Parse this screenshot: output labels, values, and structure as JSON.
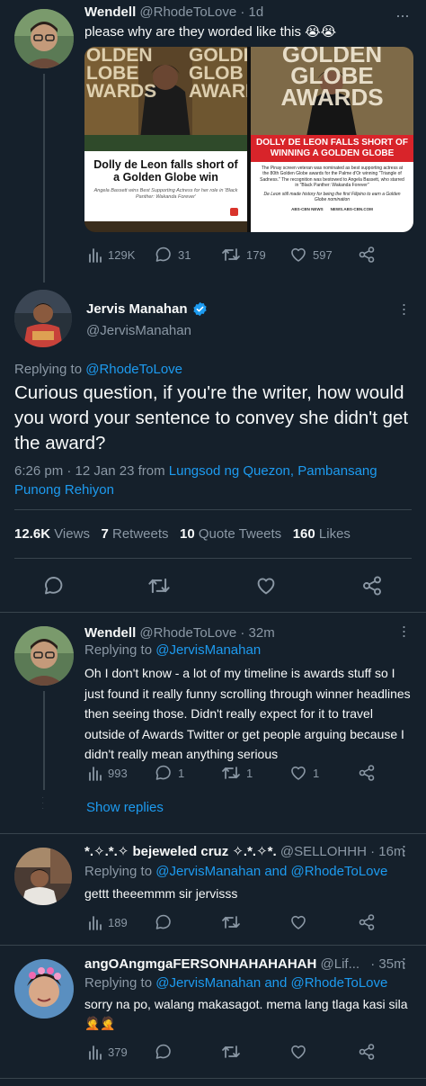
{
  "tweet1": {
    "display_name": "Wendell",
    "handle": "@RhodeToLove",
    "time": "· 1d",
    "text": "please why are they worded like this 😭😭",
    "images": [
      {
        "bg_text_lines": [
          "OLDEN",
          "LOBE",
          "WARDS"
        ],
        "bg_text_right": [
          "GOLDE",
          "GLOB",
          "AWARD"
        ],
        "headline": "Dolly de Leon falls short of a Golden Globe win",
        "subtext": "Angela Bassett wins Best Supporting Actress for her role in 'Black Panther: Wakanda Forever'"
      },
      {
        "bg_text_lines": [
          "GOLDEN",
          "GLOBE",
          "AWARDS"
        ],
        "headline": "DOLLY DE LEON FALLS SHORT OF WINNING A GOLDEN GLOBE",
        "body": "The Pinay screen veteran was nominated as best supporting actress at the 80th Golden Globe awards for the Palme d'Or winning \"Triangle of Sadness.\" The recognition was bestowed to Angela Bassett, who starred in \"Black Panther: Wakanda Forever\"",
        "footer": "De Leon still made history for being the first Filipino to earn a Golden Globe nomination",
        "logos": [
          "ABS-CBN NEWS",
          "NEWS.ABS-CBN.COM"
        ]
      }
    ],
    "stats": {
      "views": "129K",
      "replies": "31",
      "retweets": "179",
      "likes": "597"
    }
  },
  "main_tweet": {
    "display_name": "Jervis Manahan",
    "handle": "@JervisManahan",
    "verified": true,
    "replying_prefix": "Replying to",
    "replying_to": "@RhodeToLove",
    "text": "Curious question, if you're the writer, how would you word your sentence to convey she didn't get the award?",
    "timestamp": "6:26 pm · 12 Jan 23 from",
    "location_a": "Lungsod ng Quezon,",
    "location_b": "Pambansang",
    "location_c": "Punong Rehiyon",
    "views_count": "12.6K",
    "views_label": "Views",
    "retweets_count": "7",
    "retweets_label": "Retweets",
    "quotes_count": "10",
    "quotes_label": "Quote Tweets",
    "likes_count": "160",
    "likes_label": "Likes"
  },
  "reply1": {
    "display_name": "Wendell",
    "handle": "@RhodeToLove",
    "time": "· 32m",
    "replying_prefix": "Replying to",
    "replying_to": "@JervisManahan",
    "text": "Oh I don't know - a lot of my timeline is awards stuff so I just found it really funny scrolling through winner headlines then seeing those. Didn't really expect for it to travel outside of Awards Twitter or get people arguing because I didn't really mean anything serious",
    "stats": {
      "views": "993",
      "replies": "1",
      "retweets": "1",
      "likes": "1"
    },
    "show_replies": "Show replies"
  },
  "reply2": {
    "display_name": "*.✧.*.✧ bejeweled cruz ✧.*.✧*.",
    "handle": "@SELLOHHH",
    "time": "· 16m",
    "replying_prefix": "Replying to",
    "replying_to_a": "@JervisManahan",
    "and": "and",
    "replying_to_b": "@RhodeToLove",
    "text": "gettt theeemmm sir jervisss",
    "stats": {
      "views": "189"
    }
  },
  "reply3": {
    "display_name": "angOAngmgaFERSONHAHAHAHAH",
    "handle": "@Lif...",
    "time": "· 35m",
    "replying_prefix": "Replying to",
    "replying_to_a": "@JervisManahan",
    "and": "and",
    "replying_to_b": "@RhodeToLove",
    "text": "sorry na po, walang makasagot. mema lang tlaga kasi sila🤦🤦",
    "stats": {
      "views": "379"
    }
  },
  "colors": {
    "background": "#15202b",
    "text": "#f7f9f9",
    "muted": "#8b98a5",
    "accent": "#1d9bf0",
    "divider": "#38444d"
  },
  "icons": {
    "views": "bar-chart-icon",
    "reply": "speech-bubble-icon",
    "retweet": "retweet-icon",
    "like": "heart-icon",
    "share": "share-icon",
    "verified": "verified-badge-icon",
    "more": "more-dots-icon"
  }
}
